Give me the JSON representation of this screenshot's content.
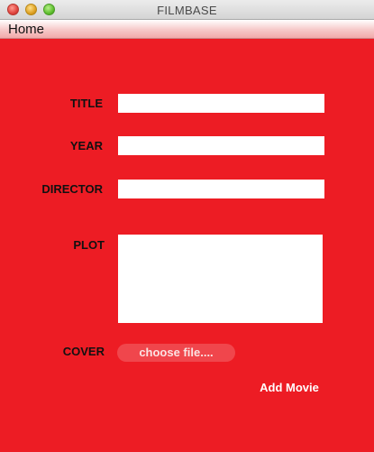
{
  "window": {
    "title": "FILMBASE"
  },
  "menu": {
    "home_label": "Home"
  },
  "form": {
    "title_label": "TITLE",
    "title_value": "",
    "year_label": "YEAR",
    "year_value": "",
    "director_label": "DIRECTOR",
    "director_value": "",
    "plot_label": "PLOT",
    "plot_value": "",
    "cover_label": "COVER",
    "choose_file_label": "choose file....",
    "add_button_label": "Add Movie"
  },
  "colors": {
    "background": "#ed1c24",
    "field": "#ffffff",
    "choose_file_button": "#f0464c"
  }
}
